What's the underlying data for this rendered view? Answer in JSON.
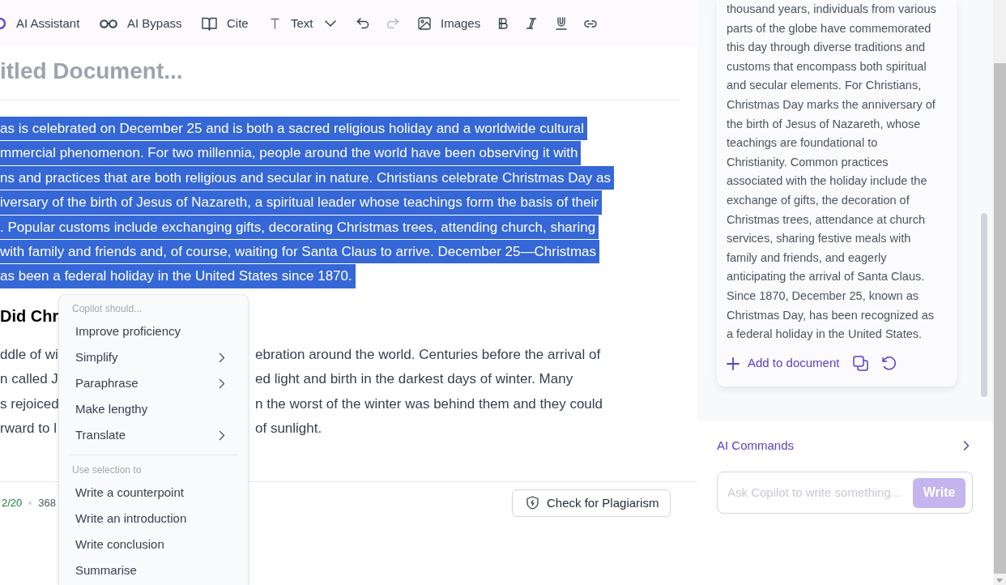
{
  "toolbar": {
    "items": [
      {
        "kind": "labeled",
        "label": "AI Assistant",
        "disabled": false
      },
      {
        "kind": "labeled",
        "label": "AI Bypass",
        "disabled": false
      },
      {
        "kind": "labeled",
        "label": "Cite",
        "disabled": false
      },
      {
        "kind": "dropdown",
        "label": "Text",
        "disabled": false
      },
      {
        "kind": "icon",
        "disabled": false
      },
      {
        "kind": "icon",
        "disabled": true
      },
      {
        "kind": "labeled",
        "label": "Images",
        "disabled": false
      },
      {
        "kind": "icon",
        "disabled": false
      },
      {
        "kind": "icon",
        "disabled": false
      },
      {
        "kind": "icon",
        "disabled": false
      },
      {
        "kind": "icon",
        "disabled": false
      }
    ]
  },
  "document": {
    "title": "itled Document...",
    "intro": {
      "selected": true,
      "lines": [
        "as is celebrated on December 25 and is both a sacred religious holiday and a worldwide cultural",
        "mmercial phenomenon. For two millennia, people around the world have been observing it with",
        "ns and practices that are both religious and secular in nature. Christians celebrate Christmas Day as",
        "iversary of the birth of Jesus of Nazareth, a spiritual leader whose teachings form the basis of their",
        ". Popular customs include exchanging gifts, decorating Christmas trees, attending church, sharing",
        "with family and friends and, of course, waiting for Santa Claus to arrive. December 25—Christmas",
        "as been a federal holiday in the United States since 1870."
      ]
    },
    "heading": "Did Chr",
    "body": {
      "left_lines": [
        "ddle of wi",
        "n called J",
        "s rejoiced",
        "rward to l"
      ],
      "right_lines": [
        "ebration around the world. Centuries before the arrival of",
        "ed light and birth in the darkest days of winter. Many",
        "n the worst of the winter was behind them and they could",
        "of sunlight."
      ]
    }
  },
  "footer": {
    "goal": "2/20",
    "word_count": "368",
    "plagiarism_button": "Check for Plagiarism"
  },
  "context_menu": {
    "sections": [
      {
        "header": "Copilot should...",
        "items": [
          {
            "label": "Improve proficiency",
            "submenu": false
          },
          {
            "label": "Simplify",
            "submenu": true
          },
          {
            "label": "Paraphrase",
            "submenu": true
          },
          {
            "label": "Make lengthy",
            "submenu": false
          },
          {
            "label": "Translate",
            "submenu": true
          }
        ]
      },
      {
        "header": "Use selection to",
        "items": [
          {
            "label": "Write a counterpoint",
            "submenu": false
          },
          {
            "label": "Write an introduction",
            "submenu": false
          },
          {
            "label": "Write conclusion",
            "submenu": false
          },
          {
            "label": "Summarise",
            "submenu": false
          }
        ]
      }
    ]
  },
  "copilot_panel": {
    "answer_lines": [
      "thousand years, individuals from various",
      "parts of the globe have commemorated",
      "this day through diverse traditions and",
      "customs that encompass both spiritual",
      "and secular elements. For Christians,",
      "Christmas Day marks the anniversary of",
      "the birth of Jesus of Nazareth, whose",
      "teachings are foundational to",
      "Christianity. Common practices",
      "associated with the holiday include the",
      "exchange of gifts, the decoration of",
      "Christmas trees, attendance at church",
      "services, sharing festive meals with",
      "family and friends, and eagerly",
      "anticipating the arrival of Santa Claus.",
      "Since 1870, December 25, known as",
      "Christmas Day, has been recognized as",
      "a federal holiday in the United States."
    ],
    "add_button": "Add to document",
    "commands_label": "AI Commands",
    "prompt": {
      "placeholder": "Ask Copilot to write something...",
      "button": "Write",
      "button_disabled": true
    }
  }
}
